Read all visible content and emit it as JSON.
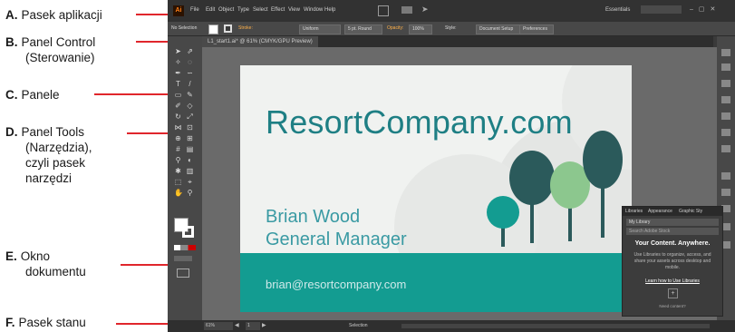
{
  "callouts": [
    {
      "letter": "A.",
      "label": "Pasek aplikacji"
    },
    {
      "letter": "B.",
      "label": "Panel Control",
      "label2": "(Sterowanie)"
    },
    {
      "letter": "C.",
      "label": "Panele"
    },
    {
      "letter": "D.",
      "label": "Panel Tools",
      "label2": "(Narzędzia),",
      "label3": "czyli pasek",
      "label4": "narzędzi"
    },
    {
      "letter": "E.",
      "label": "Okno",
      "label2": "dokumentu"
    },
    {
      "letter": "F.",
      "label": "Pasek stanu"
    }
  ],
  "app": {
    "logo": "Ai",
    "menu": [
      "File",
      "Edit",
      "Object",
      "Type",
      "Select",
      "Effect",
      "View",
      "Window",
      "Help"
    ],
    "workspace": "Essentials",
    "control": {
      "label": "No Selection",
      "stroke_label": "Stroke:",
      "stroke_value": "Uniform",
      "brush_value": "5 pt. Round",
      "opacity_label": "Opacity:",
      "opacity_value": "100%",
      "style_label": "Style:",
      "document_setup": "Document Setup",
      "preferences": "Preferences"
    },
    "tab_label": "L1_start1.ai* @ 61% (CMYK/GPU Preview)",
    "status": {
      "zoom": "61%",
      "artboard": "1",
      "mode": "Selection"
    }
  },
  "artboard": {
    "company": "ResortCompany.com",
    "name": "Brian Wood",
    "title": "General Manager",
    "email": "brian@resortcompany.com"
  },
  "libraries_panel": {
    "tabs": [
      "Libraries",
      "Appearance",
      "Graphic Sty"
    ],
    "library": "My Library",
    "search": "Search Adobe Stock",
    "heading": "Your Content. Anywhere.",
    "body": "Use Libraries to organize, access, and share your assets across desktop and mobile.",
    "link": "Learn how to Use Libraries",
    "need_content": "Need content?"
  },
  "colors": {
    "leader": "#e0262c",
    "teal": "#139c91",
    "teal_dark": "#1e7f84",
    "green_light": "#8cc78e",
    "green_dark": "#2b5a5b",
    "ui_dark": "#3a3a3a"
  }
}
